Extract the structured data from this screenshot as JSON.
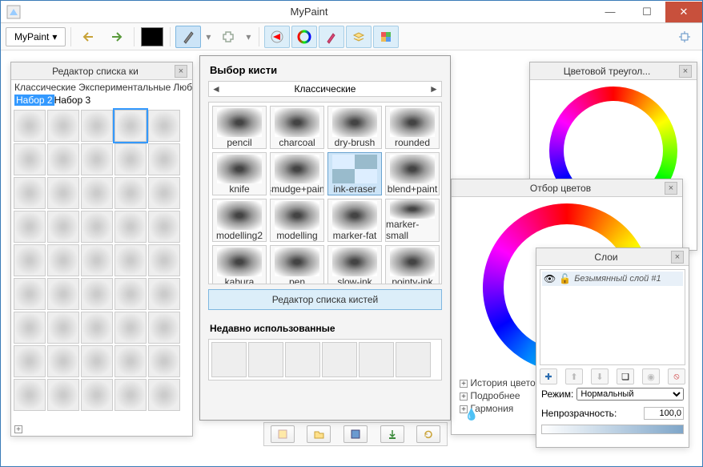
{
  "app": {
    "title": "MyPaint",
    "menu_label": "MyPaint"
  },
  "window_buttons": {
    "min": "—",
    "max": "☐",
    "close": "✕"
  },
  "panels": {
    "brush_editor": {
      "title": "Редактор списка ки",
      "tabs": [
        "Классические",
        "Экспериментальные",
        "Люб"
      ],
      "set_selected": "Набор 2",
      "set_other": "Набор 3",
      "add": "+"
    },
    "brush_picker": {
      "title": "Выбор кисти",
      "category": "Классические",
      "brushes": [
        "pencil",
        "charcoal",
        "dry-brush",
        "rounded",
        "knife",
        "smudge+paint",
        "ink-eraser",
        "blend+paint",
        "modelling2",
        "modelling",
        "marker-fat",
        "marker-small",
        "kabura",
        "pen",
        "slow-ink",
        "pointy-ink"
      ],
      "selected_brush": "ink-eraser",
      "button": "Редактор списка кистей",
      "recent_title": "Недавно использованные"
    },
    "color_triangle": {
      "title": "Цветовой треугол..."
    },
    "color_selector": {
      "title": "Отбор цветов",
      "tree": [
        "История цветов",
        "Подробнее",
        "Гармония"
      ]
    },
    "layers": {
      "title": "Слои",
      "layer_name": "Безымянный слой #1",
      "mode_label": "Режим:",
      "mode_value": "Нормальный",
      "opacity_label": "Непрозрачность:",
      "opacity_value": "100,0"
    }
  }
}
